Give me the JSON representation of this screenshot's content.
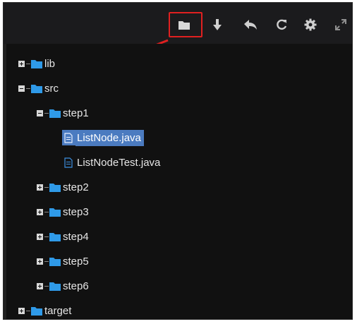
{
  "toolbar": {
    "buttons": [
      {
        "icon": "folder-icon"
      },
      {
        "icon": "download-icon"
      },
      {
        "icon": "undo-icon"
      },
      {
        "icon": "refresh-icon"
      },
      {
        "icon": "gear-icon"
      },
      {
        "icon": "expand-icon"
      }
    ],
    "highlight_color": "#e02020"
  },
  "tree": {
    "items": [
      {
        "label": "lib"
      },
      {
        "label": "src"
      },
      {
        "label": "step1"
      },
      {
        "label": "ListNode.java"
      },
      {
        "label": "ListNodeTest.java"
      },
      {
        "label": "step2"
      },
      {
        "label": "step3"
      },
      {
        "label": "step4"
      },
      {
        "label": "step5"
      },
      {
        "label": "step6"
      },
      {
        "label": "target"
      }
    ],
    "selected_color": "#4b7bc0",
    "folder_color": "#2f9ae8"
  }
}
